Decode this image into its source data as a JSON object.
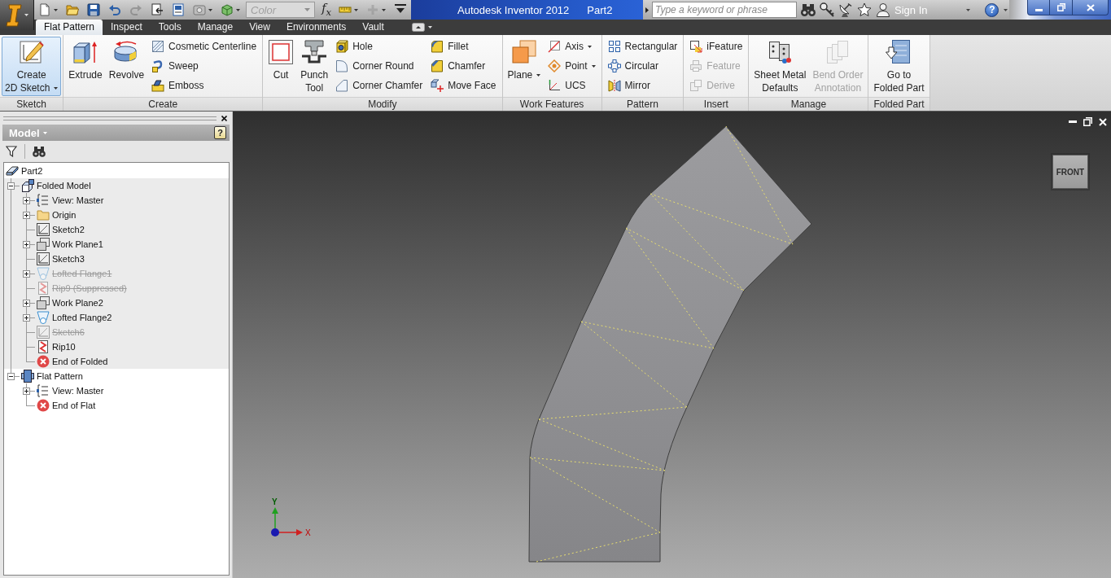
{
  "quick_access": [
    {
      "kind": "icon",
      "dropdown": true,
      "disabled": false
    },
    {
      "kind": "icon",
      "dropdown": false,
      "disabled": false
    },
    {
      "kind": "icon",
      "dropdown": false,
      "disabled": false
    },
    {
      "kind": "icon",
      "dropdown": false,
      "disabled": false
    },
    {
      "kind": "icon",
      "dropdown": false,
      "disabled": true
    },
    {
      "kind": "icon",
      "dropdown": false,
      "disabled": false
    },
    {
      "kind": "icon",
      "dropdown": false,
      "disabled": false
    },
    {
      "kind": "icon",
      "dropdown": true,
      "disabled": false
    },
    {
      "kind": "icon",
      "dropdown": true,
      "disabled": false
    },
    {
      "kind": "combo",
      "value": "Color",
      "disabled": true
    },
    {
      "kind": "text",
      "label": "f$_{x}$"
    },
    {
      "kind": "icon",
      "dropdown": true,
      "disabled": false
    },
    {
      "kind": "icon",
      "dropdown": true,
      "disabled": true
    },
    {
      "kind": "icon",
      "dropdown": false,
      "disabled": false
    }
  ],
  "title": {
    "app": "Autodesk Inventor 2012",
    "document": "Part2"
  },
  "search": {
    "placeholder": "Type a keyword or phrase"
  },
  "sign_in": {
    "label": "Sign In"
  },
  "help": {
    "label": "?"
  },
  "tabs": [
    {
      "label": "Flat Pattern",
      "selected": true
    },
    {
      "label": "Inspect",
      "selected": false
    },
    {
      "label": "Tools",
      "selected": false
    },
    {
      "label": "Manage",
      "selected": false
    },
    {
      "label": "View",
      "selected": false
    },
    {
      "label": "Environments",
      "selected": false
    },
    {
      "label": "Vault",
      "selected": false
    }
  ],
  "ribbon": {
    "panels": [
      {
        "label": "Sketch",
        "items": [
          {
            "kind": "large",
            "label": "Create\n2D Sketch",
            "dropdown": true,
            "highlighted": true,
            "disabled": false
          }
        ]
      },
      {
        "label": "Create",
        "items": [
          {
            "kind": "large",
            "label": "Extrude",
            "dropdown": false,
            "highlighted": false,
            "disabled": false
          },
          {
            "kind": "large",
            "label": "Revolve",
            "dropdown": false,
            "highlighted": false,
            "disabled": false
          },
          {
            "kind": "small",
            "label": "Cosmetic Centerline",
            "dropdown": false,
            "highlighted": false,
            "disabled": false
          },
          {
            "kind": "small",
            "label": "Sweep",
            "dropdown": false,
            "highlighted": false,
            "disabled": false
          },
          {
            "kind": "small",
            "label": "Emboss",
            "dropdown": false,
            "highlighted": false,
            "disabled": false
          }
        ]
      },
      {
        "label": "Modify",
        "items": [
          {
            "kind": "large",
            "label": "Cut",
            "dropdown": false,
            "highlighted": false,
            "disabled": false
          },
          {
            "kind": "large",
            "label": "Punch\nTool",
            "dropdown": false,
            "highlighted": false,
            "disabled": false
          },
          {
            "kind": "small",
            "label": "Hole",
            "dropdown": false,
            "highlighted": false,
            "disabled": false
          },
          {
            "kind": "small",
            "label": "Corner Round",
            "dropdown": false,
            "highlighted": false,
            "disabled": false
          },
          {
            "kind": "small",
            "label": "Corner Chamfer",
            "dropdown": false,
            "highlighted": false,
            "disabled": false
          },
          {
            "kind": "small",
            "label": "Fillet",
            "dropdown": false,
            "highlighted": false,
            "disabled": false
          },
          {
            "kind": "small",
            "label": "Chamfer",
            "dropdown": false,
            "highlighted": false,
            "disabled": false
          },
          {
            "kind": "small",
            "label": "Move Face",
            "dropdown": false,
            "highlighted": false,
            "disabled": false
          }
        ]
      },
      {
        "label": "Work Features",
        "items": [
          {
            "kind": "large",
            "label": "Plane",
            "dropdown": true,
            "highlighted": false,
            "disabled": false
          },
          {
            "kind": "small",
            "label": "Axis",
            "dropdown": true,
            "highlighted": false,
            "disabled": false
          },
          {
            "kind": "small",
            "label": "Point",
            "dropdown": true,
            "highlighted": false,
            "disabled": false
          },
          {
            "kind": "small",
            "label": "UCS",
            "dropdown": false,
            "highlighted": false,
            "disabled": false
          }
        ]
      },
      {
        "label": "Pattern",
        "items": [
          {
            "kind": "small",
            "label": "Rectangular",
            "dropdown": false,
            "highlighted": false,
            "disabled": false
          },
          {
            "kind": "small",
            "label": "Circular",
            "dropdown": false,
            "highlighted": false,
            "disabled": false
          },
          {
            "kind": "small",
            "label": "Mirror",
            "dropdown": false,
            "highlighted": false,
            "disabled": false
          }
        ]
      },
      {
        "label": "Insert",
        "items": [
          {
            "kind": "small",
            "label": "iFeature",
            "dropdown": false,
            "highlighted": false,
            "disabled": false
          },
          {
            "kind": "small",
            "label": "Feature",
            "dropdown": false,
            "highlighted": false,
            "disabled": true
          },
          {
            "kind": "small",
            "label": "Derive",
            "dropdown": false,
            "highlighted": false,
            "disabled": true
          }
        ]
      },
      {
        "label": "Manage",
        "items": [
          {
            "kind": "large",
            "label": "Sheet Metal\nDefaults",
            "dropdown": false,
            "highlighted": false,
            "disabled": false
          },
          {
            "kind": "large",
            "label": "Bend Order\nAnnotation",
            "dropdown": false,
            "highlighted": false,
            "disabled": true
          }
        ]
      },
      {
        "label": "Folded Part",
        "items": [
          {
            "kind": "large",
            "label": "Go to\nFolded Part",
            "dropdown": false,
            "highlighted": false,
            "disabled": false
          }
        ]
      }
    ]
  },
  "browser": {
    "title": "Model",
    "help": "?",
    "tree": [
      {
        "label": "Part2",
        "kind": "part",
        "suppressed": false,
        "children": [
          {
            "label": "Folded Model",
            "kind": "folded_model",
            "expanded": true,
            "shaded": true,
            "suppressed": false,
            "children": [
              {
                "label": "View: Master",
                "kind": "view",
                "expanded": false,
                "suppressed": false
              },
              {
                "label": "Origin",
                "kind": "folder",
                "expanded": false,
                "suppressed": false
              },
              {
                "label": "Sketch2",
                "kind": "sketch",
                "suppressed": false
              },
              {
                "label": "Work Plane1",
                "kind": "work_plane",
                "expanded": false,
                "suppressed": false
              },
              {
                "label": "Sketch3",
                "kind": "sketch",
                "suppressed": false
              },
              {
                "label": "Lofted Flange1",
                "kind": "lofted_flange",
                "expanded": false,
                "suppressed": true
              },
              {
                "label": "Rip9 (Suppressed)",
                "kind": "rip",
                "suppressed": true
              },
              {
                "label": "Work Plane2",
                "kind": "work_plane",
                "expanded": false,
                "suppressed": false
              },
              {
                "label": "Lofted Flange2",
                "kind": "lofted_flange",
                "expanded": false,
                "suppressed": false
              },
              {
                "label": "Sketch6",
                "kind": "sketch",
                "suppressed": true
              },
              {
                "label": "Rip10",
                "kind": "rip",
                "suppressed": false
              },
              {
                "label": "End of Folded",
                "kind": "end",
                "suppressed": false
              }
            ]
          },
          {
            "label": "Flat Pattern",
            "kind": "flat_pattern",
            "expanded": true,
            "shaded": false,
            "suppressed": false,
            "children": [
              {
                "label": "View: Master",
                "kind": "view",
                "expanded": false,
                "suppressed": false
              },
              {
                "label": "End of Flat",
                "kind": "end",
                "suppressed": false
              }
            ]
          }
        ]
      }
    ]
  },
  "viewport": {
    "view_cube": {
      "label": "FRONT"
    },
    "axes": {
      "x": "X",
      "y": "Y"
    }
  }
}
